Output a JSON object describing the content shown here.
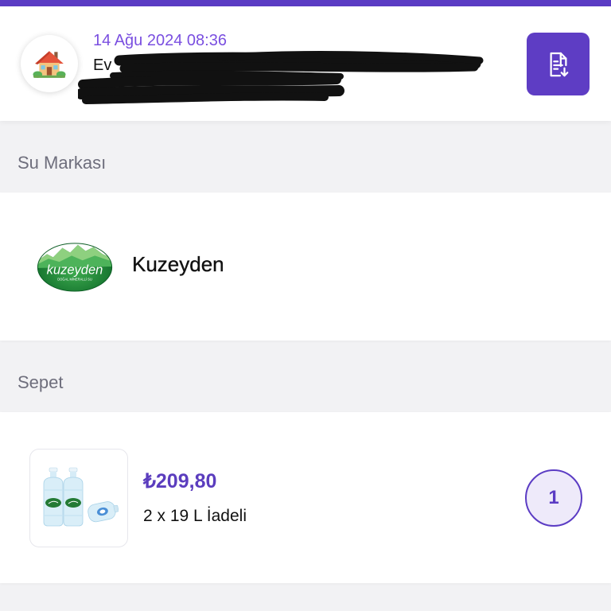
{
  "colors": {
    "accent": "#5B3CC4",
    "date_text": "#7A4FE0",
    "page_background": "#F2F2F4",
    "section_label": "#6E6E7C",
    "quantity_fill": "#EEEAFA",
    "brand_logo_green": "#1E8A3A"
  },
  "order_header": {
    "date": "14 Ağu 2024 08:36",
    "address_label": "Ev",
    "avatar_icon": "house-with-garden-icon",
    "action_icon": "document-download-icon"
  },
  "brand_section": {
    "title": "Su Markası",
    "brand": {
      "name": "Kuzeyden",
      "logo_text": "kuzeyden",
      "logo_subtext": "DOĞAL MİNERALLİ SU"
    }
  },
  "cart_section": {
    "title": "Sepet",
    "items": [
      {
        "price": "₺209,80",
        "description": "2 x 19 L İadeli",
        "quantity": "1",
        "image_icon": "water-bottles-image"
      }
    ]
  }
}
